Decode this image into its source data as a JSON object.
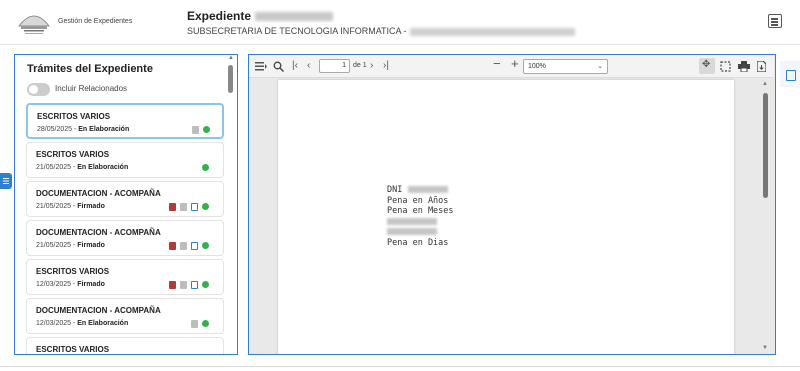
{
  "app": {
    "brand": "Gestión de Expedientes"
  },
  "expediente": {
    "title": "Expediente",
    "subtitle": "SUBSECRETARIA DE TECNOLOGIA INFORMATICA -"
  },
  "panel": {
    "title": "Trámites del Expediente",
    "toggle_label": "Incluir Relacionados",
    "toggle_on": false
  },
  "tramites": [
    {
      "title": "ESCRITOS VARIOS",
      "date": "28/05/2025 -",
      "status": "En Elaboración",
      "icons": [
        "doc",
        "ok"
      ],
      "selected": true
    },
    {
      "title": "ESCRITOS VARIOS",
      "date": "21/05/2025 -",
      "status": "En Elaboración",
      "icons": [
        "ok"
      ],
      "selected": false
    },
    {
      "title": "DOCUMENTACION - ACOMPAÑA",
      "date": "21/05/2025 -",
      "status": "Firmado",
      "icons": [
        "pdf",
        "doc",
        "img",
        "ok"
      ],
      "selected": false
    },
    {
      "title": "DOCUMENTACION - ACOMPAÑA",
      "date": "21/05/2025 -",
      "status": "Firmado",
      "icons": [
        "pdf",
        "doc",
        "img",
        "ok"
      ],
      "selected": false
    },
    {
      "title": "ESCRITOS VARIOS",
      "date": "12/03/2025 -",
      "status": "Firmado",
      "icons": [
        "pdf",
        "doc",
        "img",
        "ok"
      ],
      "selected": false
    },
    {
      "title": "DOCUMENTACION - ACOMPAÑA",
      "date": "12/03/2025 -",
      "status": "En Elaboración",
      "icons": [
        "doc",
        "ok"
      ],
      "selected": false
    },
    {
      "title": "ESCRITOS VARIOS",
      "date": "",
      "status": "",
      "icons": [],
      "selected": false
    }
  ],
  "viewer": {
    "page_value": "1",
    "page_of": "de 1",
    "zoom": "100%",
    "doc_lines": [
      {
        "label": "DNI",
        "blur": 40
      },
      {
        "label": "Pena en Años",
        "blur": 0
      },
      {
        "label": "Pena en Meses",
        "blur": 0
      },
      {
        "label": "",
        "blur": 50
      },
      {
        "label": "",
        "blur": 50
      },
      {
        "label": "Pena en Dias",
        "blur": 0
      }
    ]
  },
  "icons": {
    "menu": "menu-icon",
    "search": "search-icon",
    "first": "first-page-icon",
    "prev": "prev-page-icon",
    "next": "next-page-icon",
    "last": "last-page-icon",
    "zoom_out": "zoom-out-icon",
    "zoom_in": "zoom-in-icon",
    "pan": "pan-icon",
    "select": "marquee-select-icon",
    "print": "print-icon",
    "download": "download-icon"
  },
  "colors": {
    "accent": "#2f7fd6",
    "ok": "#2fb34a",
    "pdf": "#b33a3a"
  }
}
